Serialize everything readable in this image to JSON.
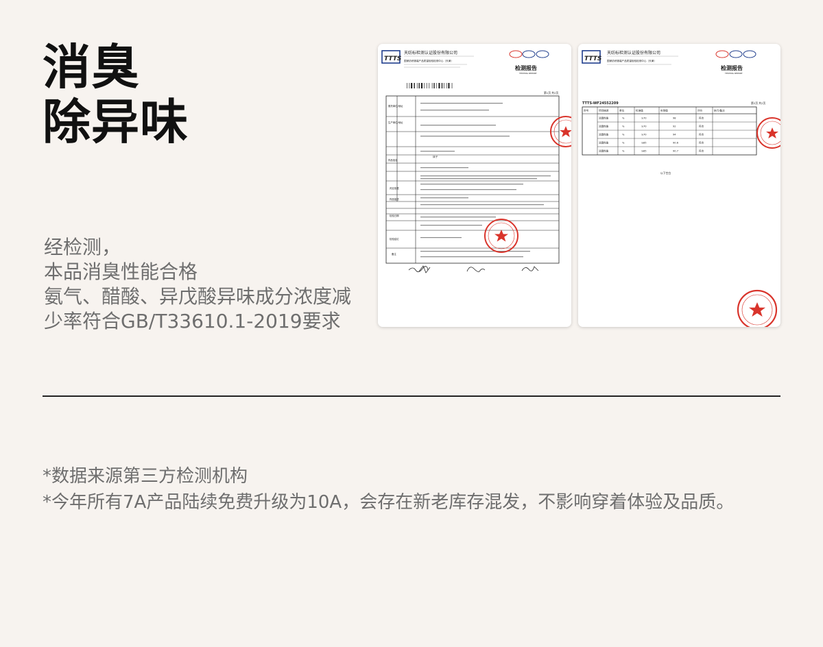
{
  "heading": {
    "line1": "消臭",
    "line2": "除异味"
  },
  "description": {
    "line1": "经检测，",
    "line2": "本品消臭性能合格",
    "line3": "氨气、醋酸、异戊酸异味成分浓度减",
    "line4": "少率符合GB/T33610.1-2019要求"
  },
  "notes": {
    "line1": "*数据来源第三方检测机构",
    "line2": "*今年所有7A产品陆续免费升级为10A，会存在新老库存混发，不影响穿着体验及品质。"
  },
  "report": {
    "logo": "TTTS",
    "org_name": "天纺标检测认证股份有限公司",
    "center_name": "国家纺织服装产品质量检验检测中心（天津）",
    "title": "检测报告",
    "title_en": "TESTING REPORT",
    "page1_label": "第1页 共2页",
    "page2_label": "第2页 共2页",
    "report_no": "TTTS-WF24552209",
    "page1_sample_name": "袜子",
    "page1_fields": {
      "client_label": "委托单位/地址",
      "producer_label": "生产单位/地址",
      "sample_info_label": "样品信息",
      "standard_label": "判定依据",
      "description_label": "样品描述",
      "date_label": "检验日期",
      "conclusion_label": "检验结论",
      "remarks_label": "备注"
    },
    "page2_header": [
      "序号",
      "项目描述",
      "单位",
      "标准值",
      "实测值",
      "评价",
      "执行/备注"
    ],
    "page2_rows": [
      {
        "item": "消臭性能",
        "unit": "%",
        "standard": "≥70",
        "result": "98",
        "evaluation": "符合"
      },
      {
        "item": "消臭性能",
        "unit": "%",
        "standard": "≥70",
        "result": "92",
        "evaluation": "符合"
      },
      {
        "item": "消臭性能",
        "unit": "%",
        "standard": "≥70",
        "result": "94",
        "evaluation": "符合"
      },
      {
        "item": "消臭性能",
        "unit": "%",
        "standard": "≥85",
        "result": "90.6",
        "evaluation": "符合"
      },
      {
        "item": "消臭性能",
        "unit": "%",
        "standard": "≥85",
        "result": "90.7",
        "evaluation": "符合"
      }
    ],
    "page2_end": "以下空白",
    "stamp_color": "#d9342b",
    "logo_color": "#1e3c8c"
  }
}
